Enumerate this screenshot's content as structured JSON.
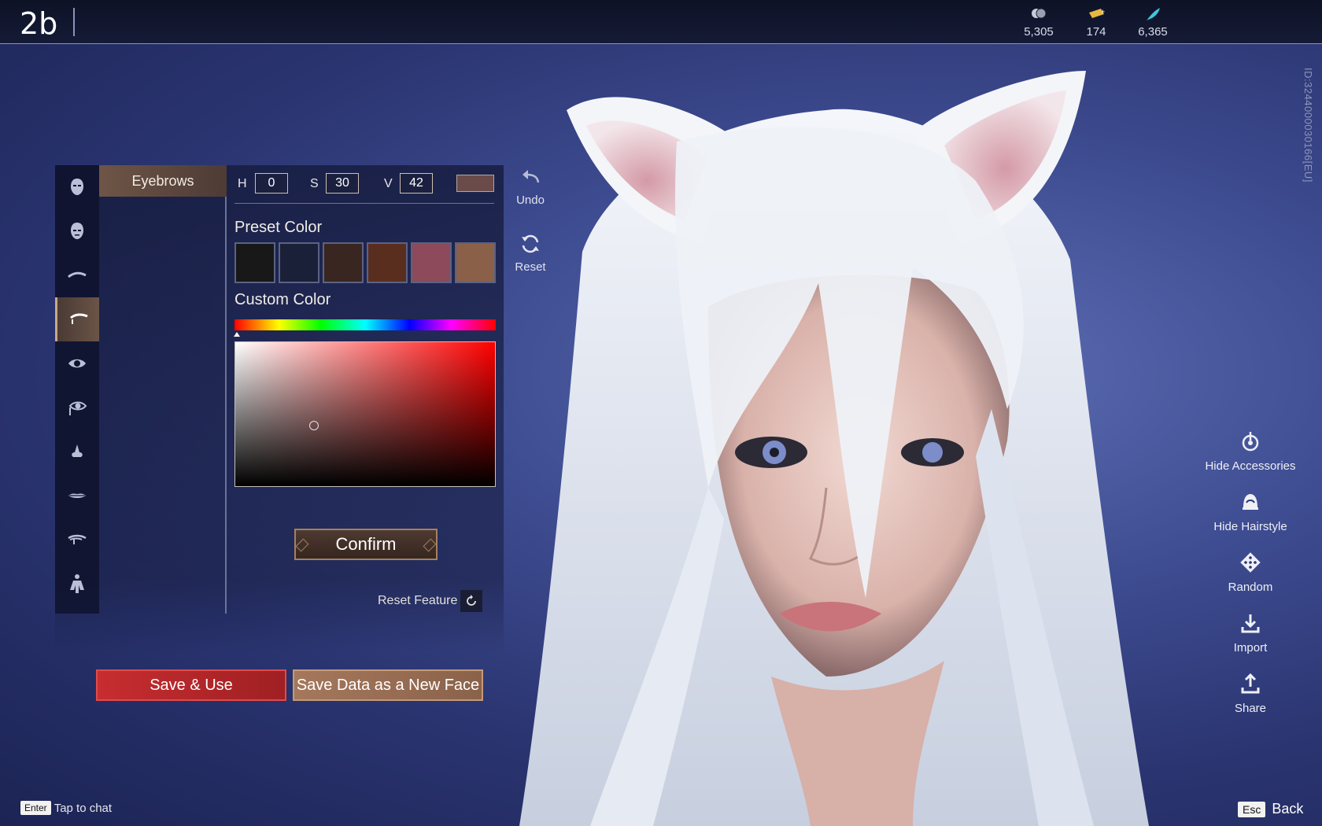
{
  "header": {
    "title": "2b",
    "currencies": [
      {
        "icon": "silver-coin-icon",
        "value": "5,305"
      },
      {
        "icon": "gold-ticket-icon",
        "value": "174"
      },
      {
        "icon": "feather-icon",
        "value": "6,365"
      }
    ]
  },
  "character_id": "ID:3244000030166[EU]",
  "categories": [
    {
      "name": "head-shape-icon"
    },
    {
      "name": "face-shape-icon"
    },
    {
      "name": "brow-ridge-icon"
    },
    {
      "name": "eyebrows-icon",
      "active": true
    },
    {
      "name": "eye-icon"
    },
    {
      "name": "eye-detail-icon"
    },
    {
      "name": "nose-icon"
    },
    {
      "name": "mouth-icon"
    },
    {
      "name": "ear-icon"
    },
    {
      "name": "body-icon"
    }
  ],
  "subtab": {
    "label": "Eyebrows"
  },
  "hsv": {
    "h_label": "H",
    "h": "0",
    "s_label": "S",
    "s": "30",
    "v_label": "V",
    "v": "42",
    "current_color": "#6b4a4a"
  },
  "preset_color": {
    "title": "Preset Color",
    "swatches": [
      "#181818",
      "#1a2038",
      "#3a2620",
      "#5a2e1f",
      "#8c4a5a",
      "#8a6048"
    ]
  },
  "custom_color": {
    "title": "Custom Color"
  },
  "confirm_label": "Confirm",
  "reset_feature_label": "Reset Feature",
  "undo_label": "Undo",
  "reset_label": "Reset",
  "buttons": {
    "save_use": "Save & Use",
    "save_new": "Save Data as a New Face"
  },
  "right_tools": [
    {
      "label": "Hide Accessories",
      "icon": "accessory-icon"
    },
    {
      "label": "Hide Hairstyle",
      "icon": "hairstyle-icon"
    },
    {
      "label": "Random",
      "icon": "dice-icon"
    },
    {
      "label": "Import",
      "icon": "import-icon"
    },
    {
      "label": "Share",
      "icon": "share-icon"
    }
  ],
  "footer": {
    "enter_key": "Enter",
    "chat_label": "Tap to chat",
    "esc_key": "Esc",
    "back_label": "Back"
  }
}
